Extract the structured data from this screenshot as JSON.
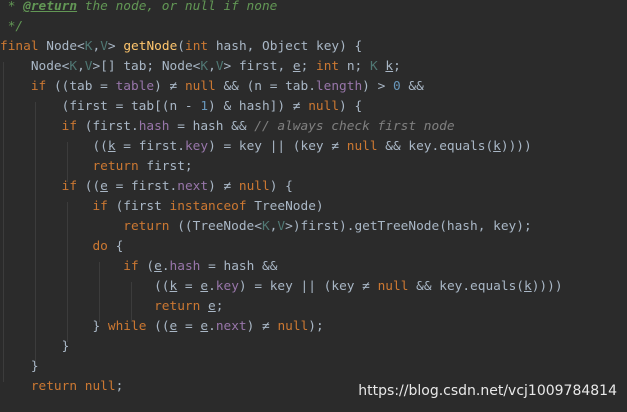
{
  "colors": {
    "background": "#2b2b2b",
    "plain": "#a9b7c6",
    "keyword": "#cc7832",
    "comment": "#629755",
    "comment_tag": "#629755",
    "method": "#ffc66d",
    "field": "#9876aa",
    "type_param": "#507874",
    "number": "#6897bb",
    "line_comment": "#808080",
    "watermark": "#e8e8e8"
  },
  "code_lines": [
    [
      [
        "comment",
        " * "
      ],
      [
        "comment_tag",
        "@return"
      ],
      [
        "comment",
        " the node, or null if none"
      ]
    ],
    [
      [
        "comment",
        " */"
      ]
    ],
    [
      [
        "keyword",
        "final "
      ],
      [
        "plain",
        "Node<"
      ],
      [
        "type_param",
        "K"
      ],
      [
        "plain",
        ","
      ],
      [
        "type_param",
        "V"
      ],
      [
        "plain",
        "> "
      ],
      [
        "method",
        "getNode"
      ],
      [
        "plain",
        "("
      ],
      [
        "keyword",
        "int "
      ],
      [
        "plain",
        "hash, Object key) {"
      ]
    ],
    [
      [
        "plain",
        "    Node<"
      ],
      [
        "type_param",
        "K"
      ],
      [
        "plain",
        ","
      ],
      [
        "type_param",
        "V"
      ],
      [
        "plain",
        ">[] tab; Node<"
      ],
      [
        "type_param",
        "K"
      ],
      [
        "plain",
        ","
      ],
      [
        "type_param",
        "V"
      ],
      [
        "plain",
        "> first, "
      ],
      [
        "plain_u",
        "e"
      ],
      [
        "plain",
        "; "
      ],
      [
        "keyword",
        "int "
      ],
      [
        "plain",
        "n; "
      ],
      [
        "type_param",
        "K "
      ],
      [
        "plain_u",
        "k"
      ],
      [
        "plain",
        ";"
      ]
    ],
    [
      [
        "keyword",
        "    if "
      ],
      [
        "plain",
        "((tab = "
      ],
      [
        "field",
        "table"
      ],
      [
        "plain",
        ") ≠ "
      ],
      [
        "keyword",
        "null "
      ],
      [
        "plain",
        "&& (n = tab."
      ],
      [
        "field",
        "length"
      ],
      [
        "plain",
        ") > "
      ],
      [
        "number",
        "0 "
      ],
      [
        "plain",
        "&&"
      ]
    ],
    [
      [
        "plain",
        "        (first = tab[(n - "
      ],
      [
        "number",
        "1"
      ],
      [
        "plain",
        ") & hash]) ≠ "
      ],
      [
        "keyword",
        "null"
      ],
      [
        "plain",
        ") {"
      ]
    ],
    [
      [
        "keyword",
        "        if "
      ],
      [
        "plain",
        "(first."
      ],
      [
        "field",
        "hash "
      ],
      [
        "plain",
        "= hash && "
      ],
      [
        "line_comment",
        "// always check first node"
      ]
    ],
    [
      [
        "plain",
        "            (("
      ],
      [
        "plain_u",
        "k"
      ],
      [
        "plain",
        " = first."
      ],
      [
        "field",
        "key"
      ],
      [
        "plain",
        ") = key || (key ≠ "
      ],
      [
        "keyword",
        "null "
      ],
      [
        "plain",
        "&& key.equals("
      ],
      [
        "plain_u",
        "k"
      ],
      [
        "plain",
        "))))"
      ]
    ],
    [
      [
        "keyword",
        "            return "
      ],
      [
        "plain",
        "first;"
      ]
    ],
    [
      [
        "keyword",
        "        if "
      ],
      [
        "plain",
        "(("
      ],
      [
        "plain_u",
        "e"
      ],
      [
        "plain",
        " = first."
      ],
      [
        "field",
        "next"
      ],
      [
        "plain",
        ") ≠ "
      ],
      [
        "keyword",
        "null"
      ],
      [
        "plain",
        ") {"
      ]
    ],
    [
      [
        "keyword",
        "            if "
      ],
      [
        "plain",
        "(first "
      ],
      [
        "keyword",
        "instanceof "
      ],
      [
        "plain",
        "TreeNode)"
      ]
    ],
    [
      [
        "keyword",
        "                return "
      ],
      [
        "plain",
        "((TreeNode<"
      ],
      [
        "type_param",
        "K"
      ],
      [
        "plain",
        ","
      ],
      [
        "type_param",
        "V"
      ],
      [
        "plain",
        ">)first).getTreeNode(hash, key);"
      ]
    ],
    [
      [
        "keyword",
        "            do "
      ],
      [
        "plain",
        "{"
      ]
    ],
    [
      [
        "keyword",
        "                if "
      ],
      [
        "plain",
        "("
      ],
      [
        "plain_u",
        "e"
      ],
      [
        "plain",
        "."
      ],
      [
        "field",
        "hash "
      ],
      [
        "plain",
        "= hash &&"
      ]
    ],
    [
      [
        "plain",
        "                    (("
      ],
      [
        "plain_u",
        "k"
      ],
      [
        "plain",
        " = "
      ],
      [
        "plain_u",
        "e"
      ],
      [
        "plain",
        "."
      ],
      [
        "field",
        "key"
      ],
      [
        "plain",
        ") = key || (key ≠ "
      ],
      [
        "keyword",
        "null "
      ],
      [
        "plain",
        "&& key.equals("
      ],
      [
        "plain_u",
        "k"
      ],
      [
        "plain",
        "))))"
      ]
    ],
    [
      [
        "keyword",
        "                    return "
      ],
      [
        "plain_u",
        "e"
      ],
      [
        "plain",
        ";"
      ]
    ],
    [
      [
        "plain",
        "            } "
      ],
      [
        "keyword",
        "while "
      ],
      [
        "plain",
        "(("
      ],
      [
        "plain_u",
        "e"
      ],
      [
        "plain",
        " = "
      ],
      [
        "plain_u",
        "e"
      ],
      [
        "plain",
        "."
      ],
      [
        "field",
        "next"
      ],
      [
        "plain",
        ") ≠ "
      ],
      [
        "keyword",
        "null"
      ],
      [
        "plain",
        ");"
      ]
    ],
    [
      [
        "plain",
        "        }"
      ]
    ],
    [
      [
        "plain",
        "    }"
      ]
    ],
    [
      [
        "keyword",
        "    return null"
      ],
      [
        "plain",
        ";"
      ]
    ]
  ],
  "watermark": "https://blog.csdn.net/vcj1009784814"
}
